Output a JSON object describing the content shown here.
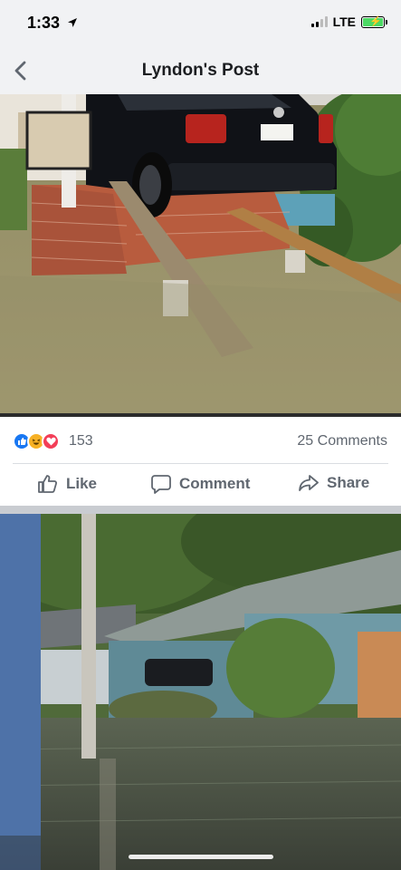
{
  "status_bar": {
    "time": "1:33",
    "network": "LTE",
    "icons": [
      "location-arrow-icon",
      "signal-icon",
      "battery-charging-icon"
    ]
  },
  "nav": {
    "title": "Lyndon's Post",
    "back_icon": "chevron-left-icon"
  },
  "post": {
    "reactions": {
      "icons": [
        "like-reaction-icon",
        "haha-reaction-icon",
        "love-reaction-icon"
      ],
      "count": "153"
    },
    "comments_count": "25 Comments",
    "actions": {
      "like_label": "Like",
      "comment_label": "Comment",
      "share_label": "Share"
    }
  },
  "colors": {
    "header_bg": "#f1f2f4",
    "like_blue": "#1877f2",
    "haha_yellow": "#f7b125",
    "love_red": "#f33e58",
    "secondary_text": "#606770"
  }
}
